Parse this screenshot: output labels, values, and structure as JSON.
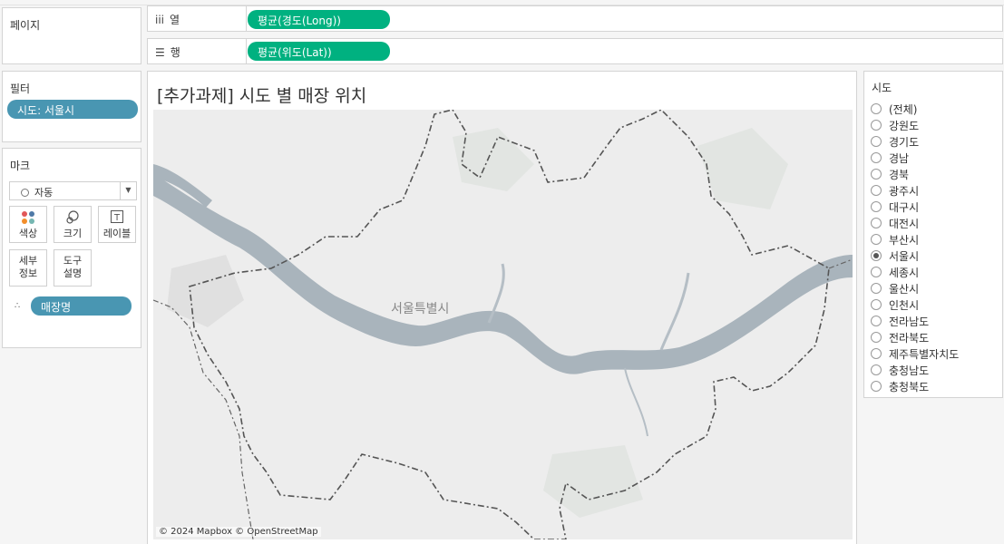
{
  "pages_panel": {
    "title": "페이지"
  },
  "filters_panel": {
    "title": "필터",
    "pill": "시도: 서울시"
  },
  "marks_panel": {
    "title": "마크",
    "mark_type": "자동",
    "buttons": {
      "color": "색상",
      "size": "크기",
      "label": "레이블",
      "detail": "세부\n정보",
      "tooltip": "도구\n설명"
    },
    "detail_pill": "매장명"
  },
  "shelves": {
    "columns": {
      "label": "열",
      "pill": "평균(경도(Long))"
    },
    "rows": {
      "label": "행",
      "pill": "평균(위도(Lat))"
    }
  },
  "view": {
    "title": "[추가과제] 시도 별 매장 위치",
    "map_label": "서울특별시",
    "attribution": "© 2024 Mapbox © OpenStreetMap",
    "mark_color": "#3f8a2e"
  },
  "sido_filter": {
    "title": "시도",
    "selected": "서울시",
    "options": [
      "(전체)",
      "강원도",
      "경기도",
      "경남",
      "경북",
      "광주시",
      "대구시",
      "대전시",
      "부산시",
      "서울시",
      "세종시",
      "울산시",
      "인천시",
      "전라남도",
      "전라북도",
      "제주특별자치도",
      "충청남도",
      "충청북도"
    ]
  }
}
